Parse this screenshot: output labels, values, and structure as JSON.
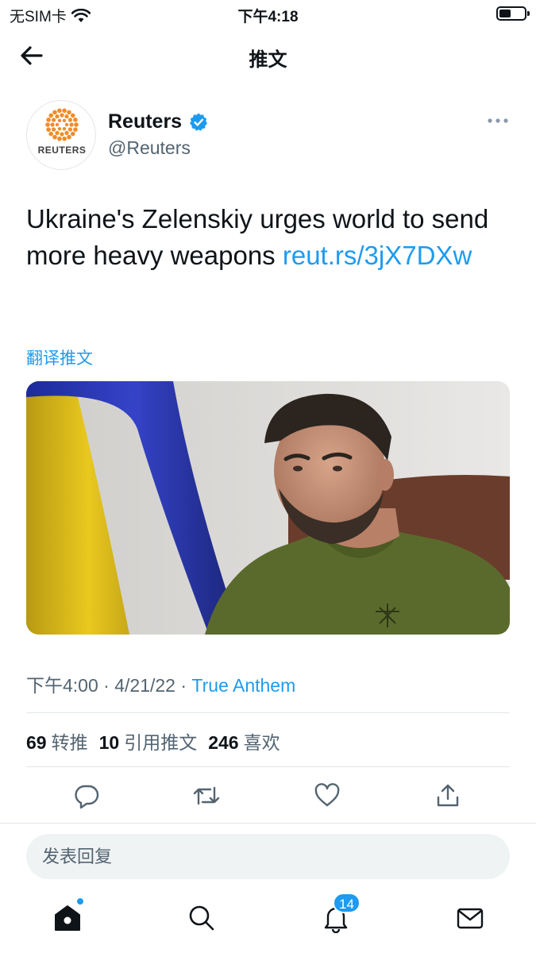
{
  "status_bar": {
    "carrier": "无SIM卡",
    "time": "下午4:18"
  },
  "nav": {
    "title": "推文"
  },
  "tweet": {
    "avatar_text": "REUTERS",
    "author_name": "Reuters",
    "author_handle": "@Reuters",
    "text": "Ukraine's Zelenskiy urges world to send more heavy weapons ",
    "link": "reut.rs/3jX7DXw",
    "translate_label": "翻译推文",
    "time": "下午4:00",
    "date": "4/21/22",
    "source": "True Anthem",
    "stats": {
      "retweets_count": "69",
      "retweets_label": "转推",
      "quotes_count": "10",
      "quotes_label": "引用推文",
      "likes_count": "246",
      "likes_label": "喜欢"
    }
  },
  "reply": {
    "placeholder": "发表回复"
  },
  "tabbar": {
    "notifications_badge": "14"
  },
  "colors": {
    "accent": "#1d9bf0",
    "text_primary": "#0f1419",
    "text_secondary": "#536471",
    "reply_bg": "#eff3f4",
    "reuters_orange": "#f28c28"
  }
}
